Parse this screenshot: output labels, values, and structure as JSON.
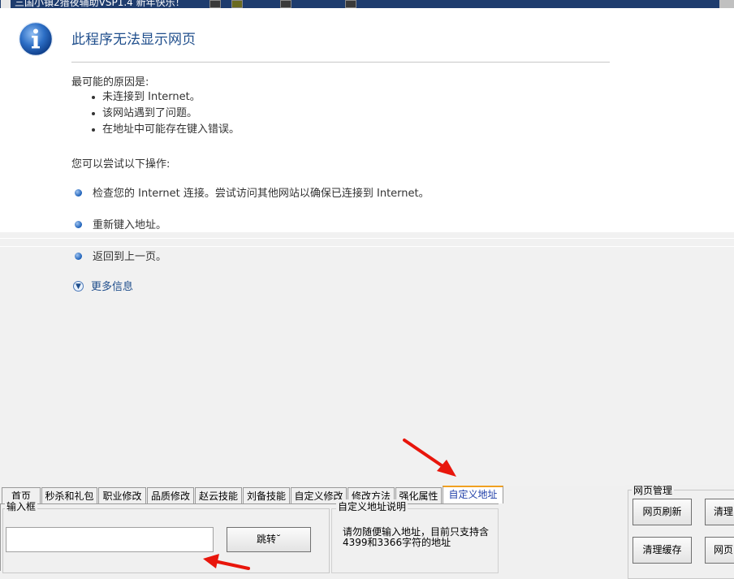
{
  "window": {
    "title": "三国小镇2猎夜辅助VSP1.4    新年快乐！"
  },
  "error_page": {
    "title": "此程序无法显示网页",
    "reasons_heading": "最可能的原因是:",
    "reasons": [
      "未连接到 Internet。",
      "该网站遇到了问题。",
      "在地址中可能存在键入错误。"
    ],
    "try_heading": "您可以尝试以下操作:",
    "actions": [
      "检查您的 Internet 连接。尝试访问其他网站以确保已连接到 Internet。",
      "重新键入地址。",
      "返回到上一页。"
    ],
    "more_info": "更多信息"
  },
  "tabs": [
    {
      "label": "首页",
      "active": false
    },
    {
      "label": "秒杀和礼包",
      "active": false
    },
    {
      "label": "职业修改",
      "active": false
    },
    {
      "label": "品质修改",
      "active": false
    },
    {
      "label": "赵云技能",
      "active": false
    },
    {
      "label": "刘备技能",
      "active": false
    },
    {
      "label": "自定义修改",
      "active": false
    },
    {
      "label": "修改方法",
      "active": false
    },
    {
      "label": "强化属性",
      "active": false
    },
    {
      "label": "自定义地址",
      "active": true
    }
  ],
  "custom_url_panel": {
    "input_group_label": "输入框",
    "input_value": "",
    "jump_button": "跳转˘",
    "desc_group_label": "自定义地址说明",
    "desc_text": "请勿随便输入地址，目前只支持含4399和3366字符的地址"
  },
  "web_manage": {
    "group_label": "网页管理",
    "refresh_button": "网页刷新",
    "clear_button_partial": "清理",
    "clear_cache_button": "清理缓存",
    "web_button_partial": "网页"
  },
  "colors": {
    "annotation_arrow": "#e8160c",
    "active_tab_text": "#1f3ea8",
    "link_blue": "#1f4e8c"
  }
}
